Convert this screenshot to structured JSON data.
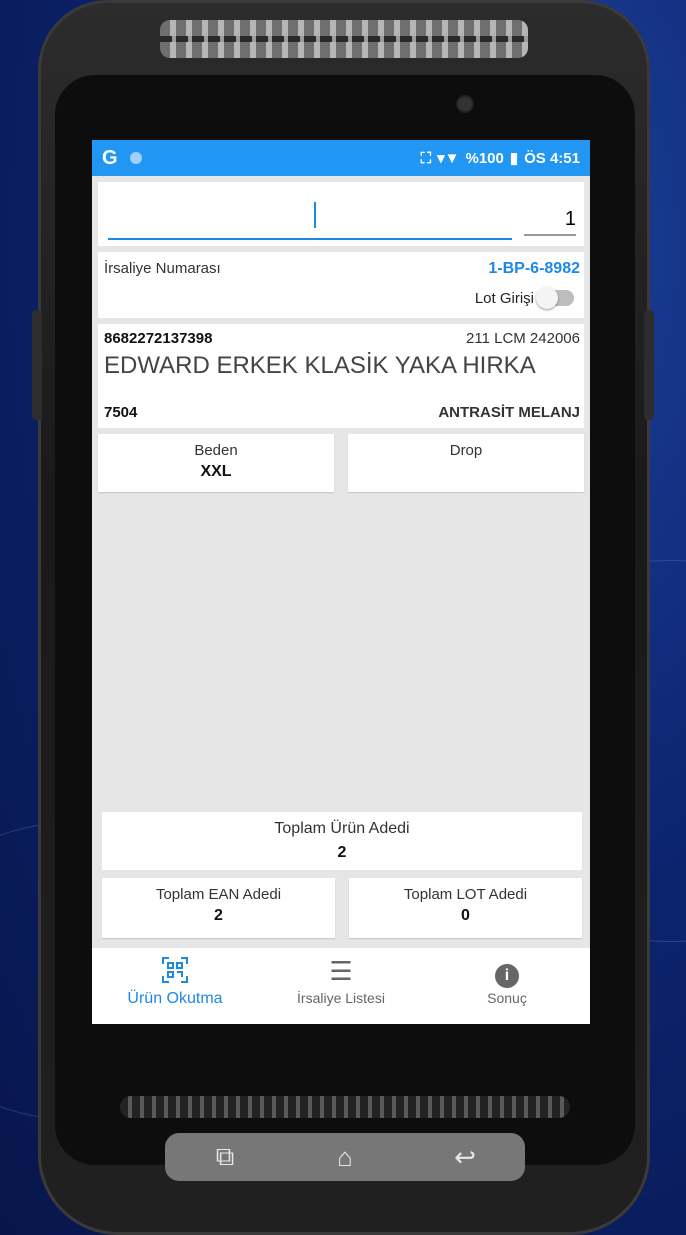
{
  "status_bar": {
    "app_letter": "G",
    "battery": "%100",
    "time": "ÖS 4:51"
  },
  "scan": {
    "barcode_value": "",
    "quantity": "1"
  },
  "irsaliye": {
    "label": "İrsaliye Numarası",
    "number": "1-BP-6-8982",
    "lot_label": "Lot Girişi",
    "lot_enabled": false
  },
  "product": {
    "ean": "8682272137398",
    "code": "211 LCM 242006",
    "name": "EDWARD ERKEK KLASİK YAKA HIRKA",
    "color_code": "7504",
    "color_name": "ANTRASİT MELANJ"
  },
  "attributes": {
    "beden_label": "Beden",
    "beden_value": "XXL",
    "drop_label": "Drop",
    "drop_value": ""
  },
  "totals": {
    "urun_label": "Toplam Ürün Adedi",
    "urun_value": "2",
    "ean_label": "Toplam EAN Adedi",
    "ean_value": "2",
    "lot_label": "Toplam LOT Adedi",
    "lot_value": "0"
  },
  "bottom_nav": [
    {
      "label": "Ürün Okutma",
      "icon": "qr-scan-icon",
      "active": true
    },
    {
      "label": "İrsaliye Listesi",
      "icon": "list-icon",
      "active": false
    },
    {
      "label": "Sonuç",
      "icon": "info-icon",
      "active": false
    }
  ],
  "colors": {
    "accent": "#1e88e5",
    "status_bar": "#2196f3"
  }
}
